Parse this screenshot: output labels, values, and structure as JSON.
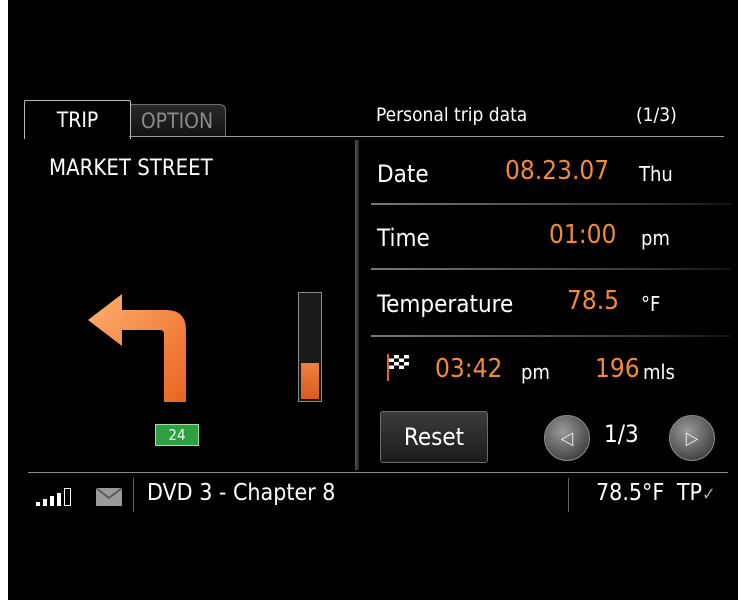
{
  "tabs": [
    {
      "label": "TRIP",
      "active": true
    },
    {
      "label": "OPTION",
      "active": false
    }
  ],
  "header": {
    "title": "Personal trip data",
    "page": "(1/3)"
  },
  "nav": {
    "street": "MARKET STREET",
    "road_badge": "24",
    "direction": "turn-left",
    "distance_level": 0.33
  },
  "trip": {
    "date": {
      "label": "Date",
      "value": "08.23.07",
      "unit": "Thu"
    },
    "time": {
      "label": "Time",
      "value": "01:00",
      "unit": "pm"
    },
    "temperature": {
      "label": "Temperature",
      "value": "78.5",
      "unit": "°F"
    },
    "arrival": {
      "time": "03:42",
      "time_unit": "pm",
      "distance": "196",
      "distance_unit": "mls"
    }
  },
  "controls": {
    "reset_label": "Reset",
    "page_indicator": "1/3"
  },
  "status": {
    "media": "DVD 3 - Chapter 8",
    "outside_temp": "78.5°F",
    "tp": "TP"
  },
  "colors": {
    "accent": "#f08a3c",
    "background": "#000000",
    "badge": "#2ea043"
  }
}
